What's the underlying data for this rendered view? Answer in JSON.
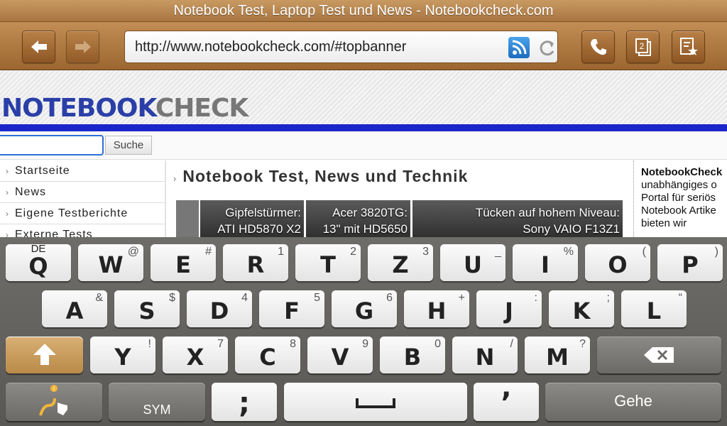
{
  "window": {
    "title": "Notebook Test, Laptop Test und News - Notebookcheck.com"
  },
  "toolbar": {
    "url": "http://www.notebookcheck.com/#topbanner",
    "tabs_count": "2"
  },
  "page": {
    "logo_part1": "NOTEBOOK",
    "logo_part2": "CHECK",
    "search_button": "Suche",
    "nav": [
      "Startseite",
      "News",
      "Eigene Testberichte",
      "Externe Tests"
    ],
    "heading": "Notebook Test, News und Technik",
    "thumbs": [
      {
        "line1": "Gipfelstürmer:",
        "line2": "ATI HD5870 X2"
      },
      {
        "line1": "Acer 3820TG:",
        "line2": "13\" mit HD5650"
      },
      {
        "line1": "Tücken auf hohem Niveau:",
        "line2": "Sony VAIO F13Z1"
      }
    ],
    "right_text_bold": "NotebookCheck",
    "right_text_lines": [
      "unabhängiges o",
      "Portal für seriös",
      "Notebook Artike",
      "bieten wir"
    ]
  },
  "keyboard": {
    "language": "DE",
    "row1": [
      {
        "k": "Q",
        "h": ""
      },
      {
        "k": "W",
        "h": "@"
      },
      {
        "k": "E",
        "h": "#"
      },
      {
        "k": "R",
        "h": "1"
      },
      {
        "k": "T",
        "h": "2"
      },
      {
        "k": "Z",
        "h": "3"
      },
      {
        "k": "U",
        "h": "_"
      },
      {
        "k": "I",
        "h": "%"
      },
      {
        "k": "O",
        "h": "("
      },
      {
        "k": "P",
        "h": ")"
      }
    ],
    "row2": [
      {
        "k": "A",
        "h": "&"
      },
      {
        "k": "S",
        "h": "$"
      },
      {
        "k": "D",
        "h": "4"
      },
      {
        "k": "F",
        "h": "5"
      },
      {
        "k": "G",
        "h": "6"
      },
      {
        "k": "H",
        "h": "+"
      },
      {
        "k": "J",
        "h": ":"
      },
      {
        "k": "K",
        "h": ";"
      },
      {
        "k": "L",
        "h": "“"
      }
    ],
    "row3": [
      {
        "k": "Y",
        "h": "!"
      },
      {
        "k": "X",
        "h": "7"
      },
      {
        "k": "C",
        "h": "8"
      },
      {
        "k": "V",
        "h": "9"
      },
      {
        "k": "B",
        "h": "0"
      },
      {
        "k": "N",
        "h": "/"
      },
      {
        "k": "M",
        "h": "?"
      }
    ],
    "sym_label": "SYM",
    "semicolon": ";",
    "apostrophe": "’",
    "go_label": "Gehe"
  }
}
